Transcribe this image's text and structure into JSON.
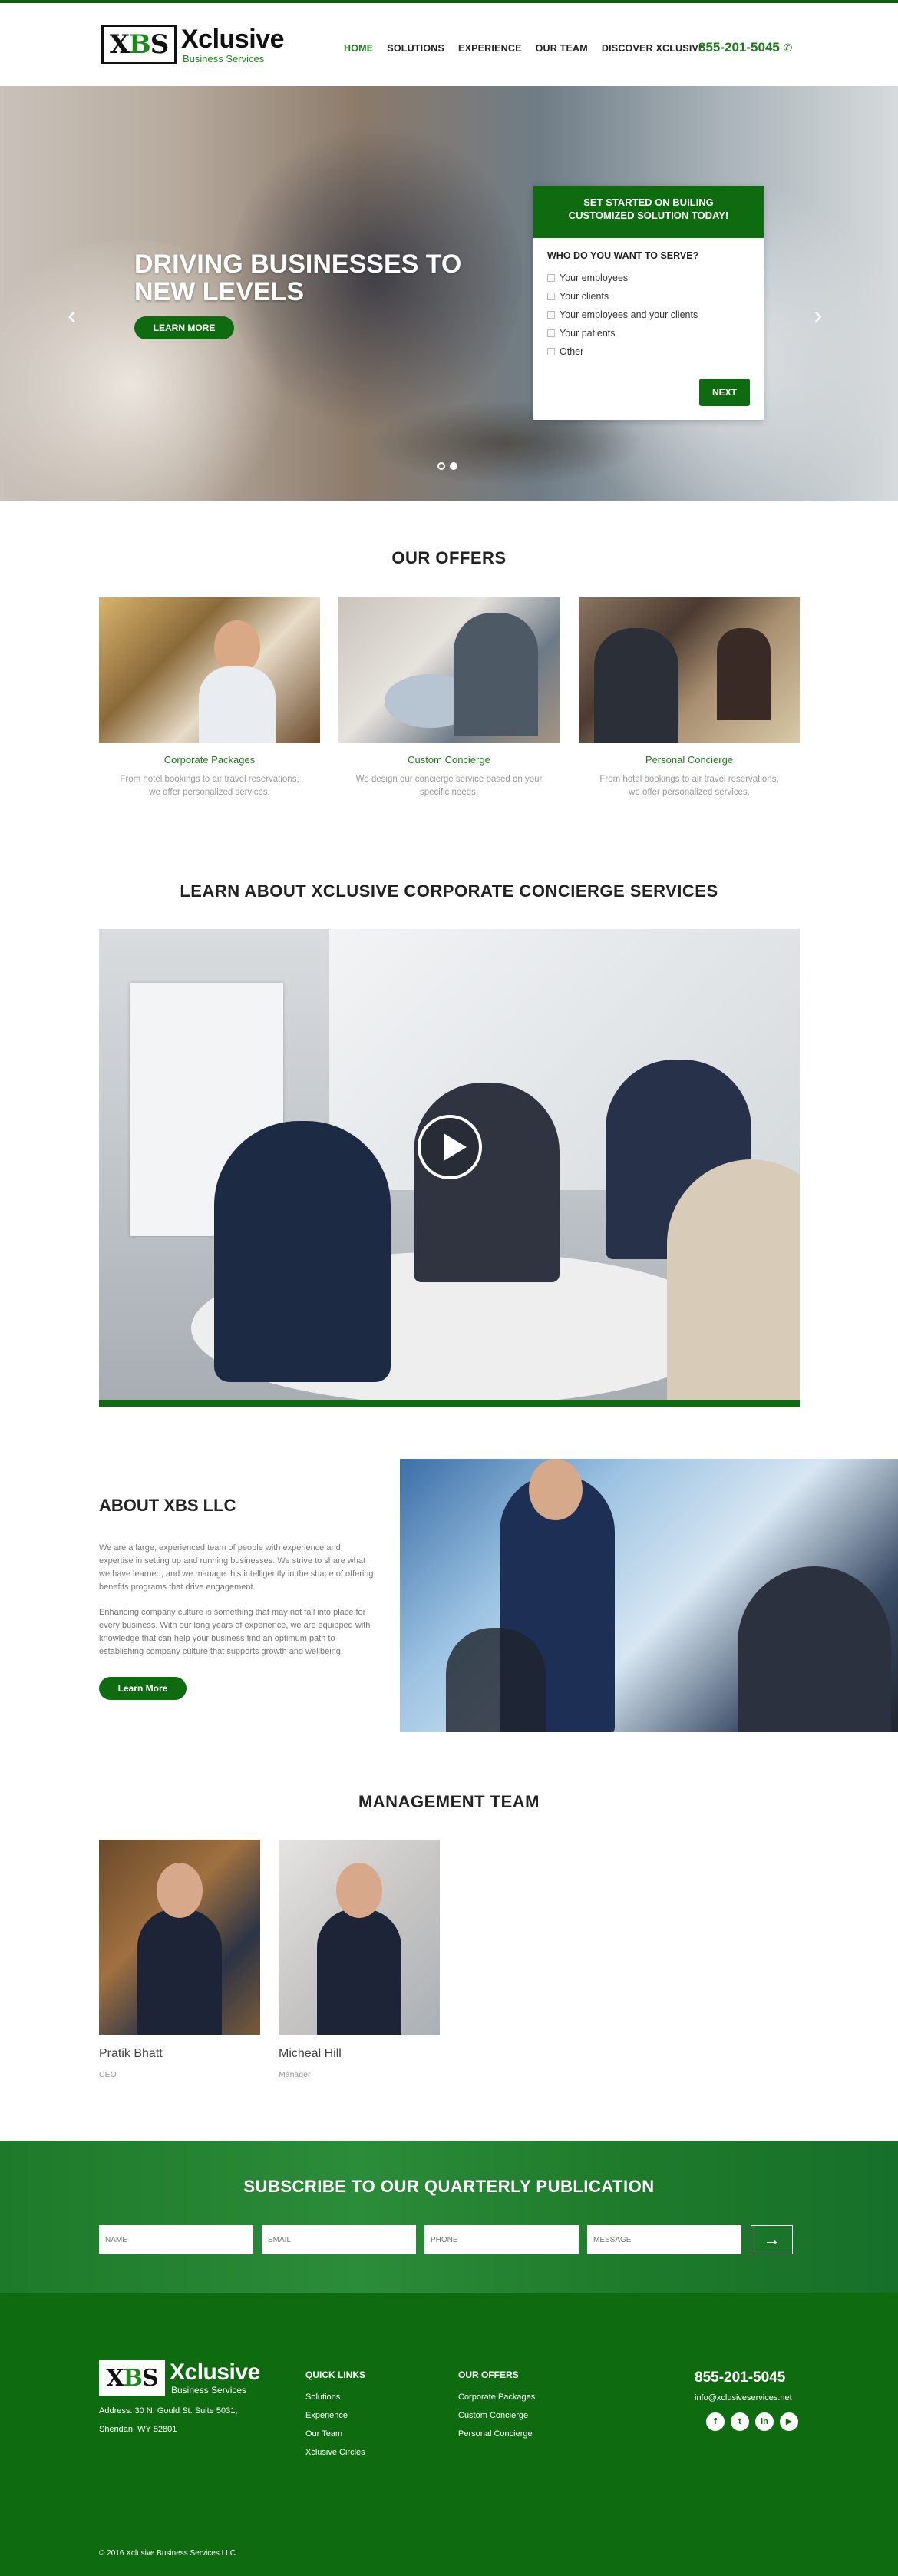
{
  "header": {
    "logo_mark": "XBS",
    "logo_name": "Xclusive",
    "logo_tagline": "Business Services",
    "nav": [
      "HOME",
      "SOLUTIONS",
      "EXPERIENCE",
      "OUR TEAM",
      "DISCOVER XCLUSIVE"
    ],
    "phone": "855-201-5045",
    "phone_icon": "phone-icon",
    "accent_color": "#1f7a1f"
  },
  "hero": {
    "title_line1": "DRIVING BUSINESSES TO",
    "title_line2": "NEW LEVELS",
    "button": "LEARN MORE",
    "prev_icon": "chevron-left-icon",
    "next_icon": "chevron-right-icon",
    "slide_count": 2,
    "active_slide": 2
  },
  "form": {
    "heading_line1": "SET STARTED ON BUILING",
    "heading_line2": "CUSTOMIZED SOLUTION TODAY!",
    "question": "WHO DO YOU WANT TO SERVE?",
    "options": [
      "Your employees",
      "Your clients",
      "Your employees and your clients",
      "Your patients",
      "Other"
    ],
    "button": "NEXT"
  },
  "offers": {
    "title": "OUR OFFERS",
    "items": [
      {
        "title": "Corporate Packages",
        "desc_line1": "From hotel bookings to air travel reservations,",
        "desc_line2": "we offer personalized services."
      },
      {
        "title": "Custom Concierge",
        "desc_line1": "We design our concierge service based on your",
        "desc_line2": "specific needs."
      },
      {
        "title": "Personal Concierge",
        "desc_line1": "From hotel bookings to air travel reservations,",
        "desc_line2": "we offer personalized services."
      }
    ]
  },
  "video": {
    "title": "LEARN ABOUT XCLUSIVE CORPORATE CONCIERGE SERVICES",
    "play_icon": "play-icon"
  },
  "about": {
    "title": "ABOUT XBS LLC",
    "para1": "We are a large, experienced team of people with experience and expertise in setting up and running businesses. We strive to share what we have learned, and we manage this intelligently in the shape of offering benefits programs that drive engagement.",
    "para2": "Enhancing company culture is something that may not fall into place for every business. With our long years of experience, we are equipped with knowledge that can help your business find an optimum path to establishing company culture that supports growth and wellbeing.",
    "button": "Learn More"
  },
  "team": {
    "title": "MANAGEMENT TEAM",
    "members": [
      {
        "name": "Pratik Bhatt",
        "role": "CEO"
      },
      {
        "name": "Micheal Hill",
        "role": "Manager"
      }
    ]
  },
  "subscribe": {
    "title": "SUBSCRIBE TO OUR QUARTERLY PUBLICATION",
    "fields": [
      "NAME",
      "EMAIL",
      "PHONE",
      "MESSAGE"
    ],
    "send_icon": "arrow-right-icon"
  },
  "footer": {
    "address_line1": "Address: 30 N. Gould St. Suite 5031,",
    "address_line2": "Sheridan, WY 82801",
    "quick_links_title": "QUICK LINKS",
    "quick_links": [
      "Solutions",
      "Experience",
      "Our Team",
      "Xclusive Circles"
    ],
    "offers_title": "OUR OFFERS",
    "offers": [
      "Corporate Packages",
      "Custom Concierge",
      "Personal Concierge"
    ],
    "phone": "855-201-5045",
    "email": "info@xclusiveservices.net",
    "social": [
      {
        "icon": "facebook-icon",
        "glyph": "f"
      },
      {
        "icon": "twitter-icon",
        "glyph": "t"
      },
      {
        "icon": "linkedin-icon",
        "glyph": "in"
      },
      {
        "icon": "youtube-icon",
        "glyph": "▶"
      }
    ],
    "copyright": "© 2016 Xclusive Business Services LLC",
    "background_color": "#0f6b10"
  }
}
